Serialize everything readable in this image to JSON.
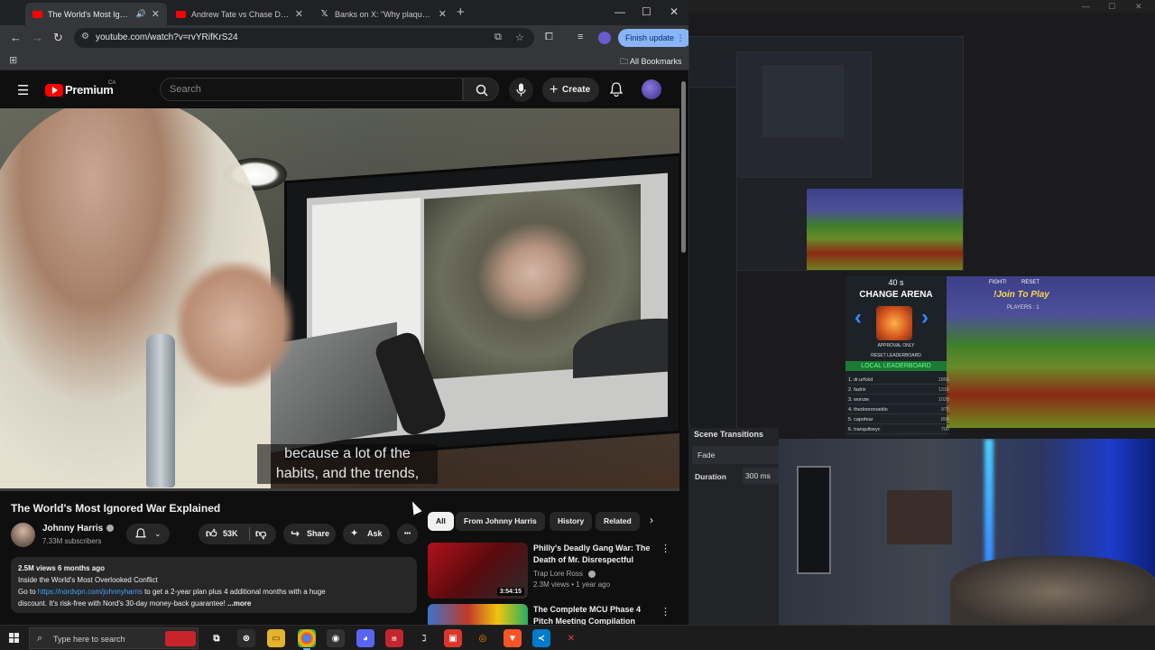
{
  "browser": {
    "tabs": [
      {
        "title": "The World's Most Ignored W",
        "active": true,
        "audio": true
      },
      {
        "title": "Andrew Tate vs Chase DeMoor",
        "active": false
      },
      {
        "title": "Banks on X: \"Why plaqueboym",
        "active": false
      }
    ],
    "url": "youtube.com/watch?v=rvYRifKrS24",
    "finish_update": "Finish update",
    "all_bookmarks": "All Bookmarks",
    "win_controls": {
      "min": "—",
      "max": "☐",
      "close": "✕"
    }
  },
  "youtube": {
    "brand": "Premium",
    "region": "CA",
    "search_placeholder": "Search",
    "create_label": "Create",
    "video": {
      "caption_line1": "because a lot of the",
      "caption_line2": "habits, and the trends,",
      "progress": 0.0,
      "title": "The World's Most Ignored War Explained"
    },
    "channel": {
      "name": "Johnny Harris",
      "subscribers": "7.33M subscribers"
    },
    "actions": {
      "likes": "53K",
      "share": "Share",
      "ask": "Ask",
      "more": "•••"
    },
    "description": {
      "meta": "2.5M views  6 months ago",
      "line1": "Inside the World's Most Overlooked Conflict",
      "line2_prefix": "Go to ",
      "link": "https://nordvpn.com/johnnyharris",
      "line2_suffix": " to get a 2-year plan plus 4 additional months with a huge",
      "line3": "discount. It's risk-free with Nord's 30-day money-back guarantee!",
      "more": "...more"
    },
    "chips": [
      "All",
      "From Johnny Harris",
      "History",
      "Related"
    ],
    "recommendations": [
      {
        "title": "Philly's Deadly Gang War: The Death of Mr. Disrespectful",
        "channel": "Trap Lore Ross",
        "meta": "2.3M views • 1 year ago",
        "duration": "3:54:15"
      },
      {
        "title": "The Complete MCU Phase 4 Pitch Meeting Compilation",
        "channel": "",
        "meta": "",
        "duration": ""
      }
    ]
  },
  "obs": {
    "arena_timer": "40 s",
    "change_arena": "CHANGE ARENA",
    "approval_only": "APPROVAL ONLY",
    "reset_leaderboard": "RESET LEADERBOARD",
    "local_leaderboard": "LOCAL LEADERBOARD",
    "fight": "FIGHT!",
    "reset": "RESET",
    "join": "!Join To Play",
    "players": "PLAYERS : 1",
    "leaderboard": [
      {
        "rank": "1. dr.urfckd",
        "score": "1866"
      },
      {
        "rank": "2. fadrix",
        "score": "1316"
      },
      {
        "rank": "3. wonzie",
        "score": "1028"
      },
      {
        "rank": "4. thedoorsnoeklo",
        "score": "975"
      },
      {
        "rank": "5. capofear",
        "score": "894"
      },
      {
        "rank": "6. tranquilseyc",
        "score": "700"
      }
    ],
    "scene_transitions": "Scene Transitions",
    "fade": "Fade",
    "duration_label": "Duration",
    "duration_value": "300 ms"
  },
  "taskbar": {
    "search_placeholder": "Type here to search"
  }
}
